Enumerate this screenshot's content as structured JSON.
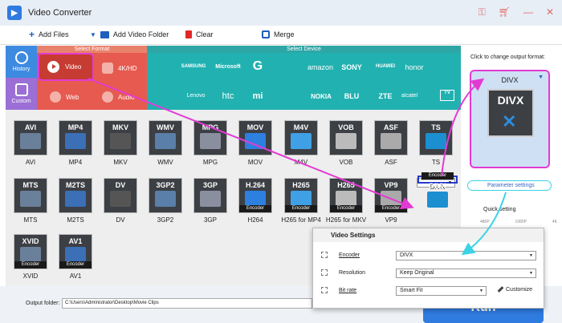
{
  "app": {
    "title": "Video Converter"
  },
  "toolbar": {
    "add_files": "Add Files",
    "add_video_folder": "Add Video Folder",
    "clear": "Clear",
    "merge": "Merge"
  },
  "left_tabs": {
    "history": "History",
    "custom": "Custom"
  },
  "headers": {
    "format": "Select Format",
    "device": "Select Device"
  },
  "format_tabs": {
    "video": "Video",
    "hd": "4K/HD",
    "web": "Web",
    "audio": "Audio"
  },
  "brands_row1": [
    "",
    "SAMSUNG",
    "Microsoft",
    "G",
    "",
    "amazon",
    "SONY",
    "HUAWEI",
    "honor",
    ""
  ],
  "brands_row2": [
    "",
    "Lenovo",
    "htc",
    "mi",
    "",
    "NOKIA",
    "BLU",
    "ZTE",
    "alcatel",
    "TV"
  ],
  "formats": [
    {
      "box": "AVI",
      "name": "AVI",
      "enc": ""
    },
    {
      "box": "MP4",
      "name": "MP4",
      "enc": ""
    },
    {
      "box": "MKV",
      "name": "MKV",
      "enc": ""
    },
    {
      "box": "WMV",
      "name": "WMV",
      "enc": ""
    },
    {
      "box": "MPG",
      "name": "MPG",
      "enc": ""
    },
    {
      "box": "MOV",
      "name": "MOV",
      "enc": ""
    },
    {
      "box": "M4V",
      "name": "M4V",
      "enc": ""
    },
    {
      "box": "VOB",
      "name": "VOB",
      "enc": ""
    },
    {
      "box": "ASF",
      "name": "ASF",
      "enc": ""
    },
    {
      "box": "TS",
      "name": "TS",
      "enc": ""
    },
    {
      "box": "MTS",
      "name": "MTS",
      "enc": ""
    },
    {
      "box": "M2TS",
      "name": "M2TS",
      "enc": ""
    },
    {
      "box": "DV",
      "name": "DV",
      "enc": ""
    },
    {
      "box": "3GP2",
      "name": "3GP2",
      "enc": ""
    },
    {
      "box": "3GP",
      "name": "3GP",
      "enc": ""
    },
    {
      "box": "H.264",
      "name": "H264",
      "enc": "Encoder"
    },
    {
      "box": "H265",
      "name": "H265 for MP4",
      "enc": "Encoder"
    },
    {
      "box": "H265",
      "name": "H265 for MKV",
      "enc": "Encoder"
    },
    {
      "box": "VP9",
      "name": "VP9",
      "enc": "Encoder"
    },
    {
      "box": "DIVX",
      "name": "DIVX",
      "enc": "Encoder"
    },
    {
      "box": "XVID",
      "name": "XVID",
      "enc": "Encoder"
    },
    {
      "box": "AV1",
      "name": "AV1",
      "enc": "Encoder"
    }
  ],
  "right_panel": {
    "hint": "Click to change output format:",
    "format": "DIVX",
    "param_settings": "Parameter settings",
    "quick_setting": "Quick setting",
    "ticks": [
      "480P",
      "1080P",
      "4K"
    ]
  },
  "bottom": {
    "output_label": "Output folder:",
    "output_path": "C:\\Users\\Administrator\\Desktop\\Movie Clips",
    "run": "Run"
  },
  "dialog": {
    "title": "Video Settings",
    "encoder_label": "Encoder",
    "encoder_value": "DIVX",
    "resolution_label": "Resolution",
    "resolution_value": "Keep Original",
    "bitrate_label": "Bit rate",
    "bitrate_value": "Smart Fit",
    "customize": "Customize"
  },
  "colors": {
    "accent": "#2f7be0",
    "format_red": "#e65a4f",
    "device_teal": "#22b1b1",
    "highlight": "#e23bd4",
    "cyan": "#3cd2e6"
  }
}
